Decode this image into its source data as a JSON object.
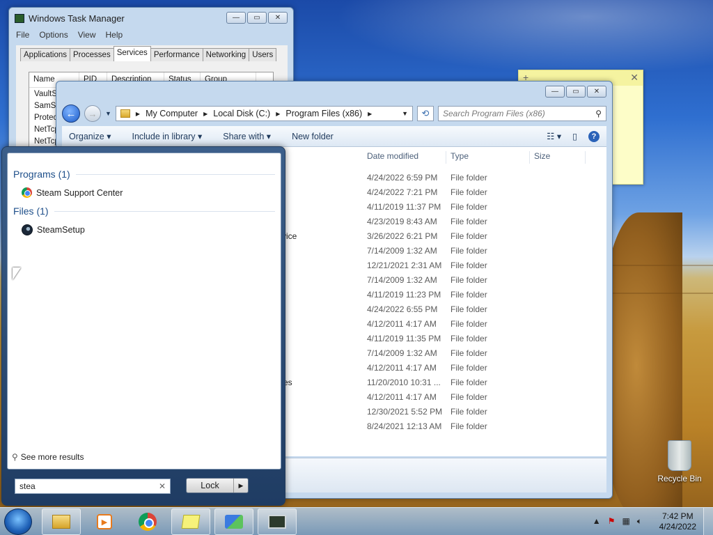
{
  "taskmgr": {
    "title": "Windows Task Manager",
    "menu": [
      "File",
      "Options",
      "View",
      "Help"
    ],
    "tabs": [
      "Applications",
      "Processes",
      "Services",
      "Performance",
      "Networking",
      "Users"
    ],
    "columns": [
      "Name",
      "PID",
      "Description",
      "Status",
      "Group"
    ],
    "rows": [
      "VaultSv",
      "SamSs",
      "Protec",
      "NetTcp",
      "NetTcp"
    ]
  },
  "explorer": {
    "breadcrumb": [
      "My Computer",
      "Local Disk (C:)",
      "Program Files (x86)"
    ],
    "search_placeholder": "Search Program Files (x86)",
    "toolbar": {
      "organize": "Organize",
      "include": "Include in library",
      "share": "Share with",
      "new_folder": "New folder"
    },
    "columns": {
      "date": "Date modified",
      "type": "Type",
      "size": "Size"
    },
    "files": [
      {
        "name": "",
        "date": "4/24/2022 6:59 PM",
        "type": "File folder"
      },
      {
        "name": "",
        "date": "4/24/2022 7:21 PM",
        "type": "File folder"
      },
      {
        "name": "",
        "date": "4/11/2019 11:37 PM",
        "type": "File folder"
      },
      {
        "name": "",
        "date": "4/23/2019 8:43 AM",
        "type": "File folder"
      },
      {
        "name": "rvice",
        "date": "3/26/2022 6:21 PM",
        "type": "File folder"
      },
      {
        "name": "",
        "date": "7/14/2009 1:32 AM",
        "type": "File folder"
      },
      {
        "name": "",
        "date": "12/21/2021 2:31 AM",
        "type": "File folder"
      },
      {
        "name": "",
        "date": "7/14/2009 1:32 AM",
        "type": "File folder"
      },
      {
        "name": "",
        "date": "4/11/2019 11:23 PM",
        "type": "File folder"
      },
      {
        "name": "",
        "date": "4/24/2022 6:55 PM",
        "type": "File folder"
      },
      {
        "name": "",
        "date": "4/12/2011 4:17 AM",
        "type": "File folder"
      },
      {
        "name": "",
        "date": "4/11/2019 11:35 PM",
        "type": "File folder"
      },
      {
        "name": "",
        "date": "7/14/2009 1:32 AM",
        "type": "File folder"
      },
      {
        "name": "",
        "date": "4/12/2011 4:17 AM",
        "type": "File folder"
      },
      {
        "name": "ces",
        "date": "11/20/2010 10:31 ...",
        "type": "File folder"
      },
      {
        "name": "",
        "date": "4/12/2011 4:17 AM",
        "type": "File folder"
      },
      {
        "name": "",
        "date": "12/30/2021 5:52 PM",
        "type": "File folder"
      },
      {
        "name": "",
        "date": "8/24/2021 12:13 AM",
        "type": "File folder"
      }
    ]
  },
  "startmenu": {
    "programs_header": "Programs (1)",
    "program_item": "Steam Support Center",
    "files_header": "Files (1)",
    "file_item": "SteamSetup",
    "see_more": "See more results",
    "search_value": "stea",
    "lock_label": "Lock"
  },
  "desktop": {
    "recycle_bin": "Recycle Bin"
  },
  "taskbar": {
    "time": "7:42 PM",
    "date": "4/24/2022"
  }
}
